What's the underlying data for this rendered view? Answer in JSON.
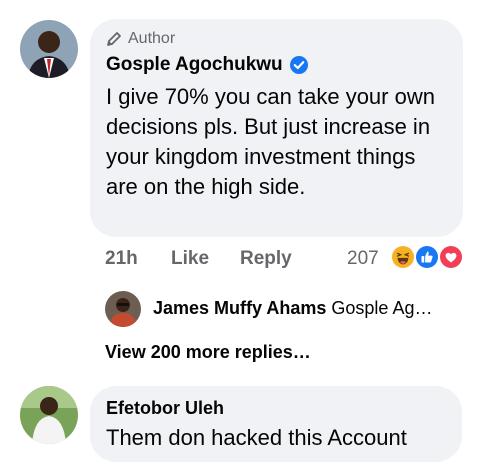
{
  "comment1": {
    "badge": "Author",
    "author": "Gosple Agochukwu",
    "text": "I give 70%  you can take your own decisions pls. But just increase in your kingdom investment things are on the high side.",
    "time": "21h",
    "like_label": "Like",
    "reply_label": "Reply",
    "reaction_count": "207",
    "reactions": [
      "haha-icon",
      "like-icon",
      "love-icon"
    ]
  },
  "reply_preview": {
    "name": "James Muffy Ahams",
    "snippet": "Gosple Ag…"
  },
  "view_more": "View 200 more replies…",
  "comment2": {
    "author": "Efetobor Uleh",
    "text": "Them don hacked this Account"
  },
  "colors": {
    "bubble": "#f0f2f5",
    "verified": "#1877f2",
    "like": "#1877f2",
    "love": "#f33e58",
    "haha": "#f7b125",
    "muted": "#65676b"
  }
}
